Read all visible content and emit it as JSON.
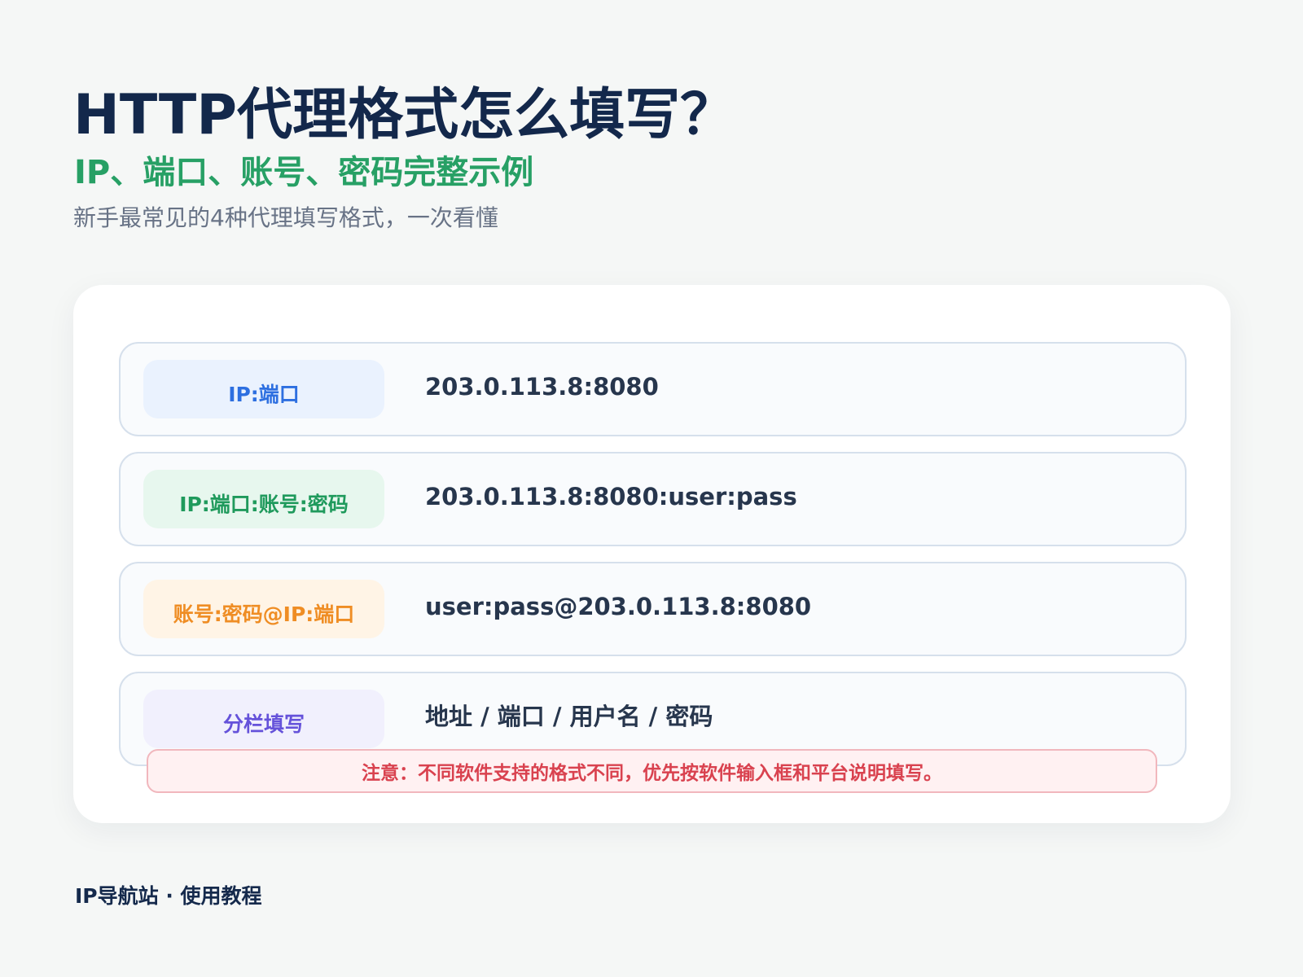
{
  "header": {
    "title": "HTTP代理格式怎么填写？",
    "subtitle": "IP、端口、账号、密码完整示例",
    "description": "新手最常见的4种代理填写格式，一次看懂"
  },
  "formats": [
    {
      "label": "IP:端口",
      "example": "203.0.113.8:8080",
      "color": "#2d6fe0"
    },
    {
      "label": "IP:端口:账号:密码",
      "example": "203.0.113.8:8080:user:pass",
      "color": "#1f9a5c"
    },
    {
      "label": "账号:密码@IP:端口",
      "example": "user:pass@203.0.113.8:8080",
      "color": "#ef8d24"
    },
    {
      "label": "分栏填写",
      "example": "地址 / 端口 / 用户名 / 密码",
      "color": "#6552da"
    }
  ],
  "note": "注意：不同软件支持的格式不同，优先按软件输入框和平台说明填写。",
  "footer": "IP导航站 · 使用教程",
  "colors": {
    "background": "#f5f7f6",
    "title": "#13284b",
    "subtitle": "#27a065",
    "warning": "#d9424f"
  }
}
